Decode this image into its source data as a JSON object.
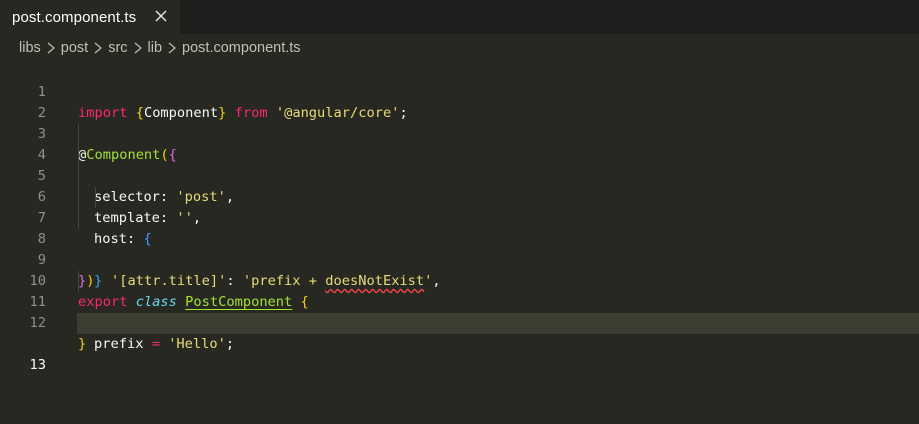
{
  "tab": {
    "label": "post.component.ts",
    "close_icon": "close-icon"
  },
  "breadcrumb": [
    "libs",
    "post",
    "src",
    "lib",
    "post.component.ts"
  ],
  "editor": {
    "current_line": 13,
    "lines": [
      {
        "n": "1"
      },
      {
        "n": "2"
      },
      {
        "n": "3"
      },
      {
        "n": "4"
      },
      {
        "n": "5"
      },
      {
        "n": "6"
      },
      {
        "n": "7"
      },
      {
        "n": "8"
      },
      {
        "n": "9"
      },
      {
        "n": "10"
      },
      {
        "n": "11"
      },
      {
        "n": "12"
      },
      {
        "n": "13"
      }
    ],
    "tokens": {
      "l1_import": "import",
      "l1_open": "{",
      "l1_component": "Component",
      "l1_close": "}",
      "l1_from": "from",
      "l1_str": "'@angular/core'",
      "l1_semi": ";",
      "l3_at": "@",
      "l3_decorator": "Component",
      "l3_paren": "(",
      "l3_brace": "{",
      "l4_key": "selector: ",
      "l4_str": "'post'",
      "l4_comma": ",",
      "l5_key": "template: ",
      "l5_str": "''",
      "l5_comma": ",",
      "l6_key": "host: ",
      "l6_brace": "{",
      "l7_key": "'[attr.title]'",
      "l7_colon": ": ",
      "l7_val1": "'prefix + ",
      "l7_err": "doesNotExist",
      "l7_val2": "'",
      "l7_comma": ",",
      "l8_brace": "}",
      "l9_brace": "}",
      "l9_paren": ")",
      "l10_export": "export",
      "l10_class": "class",
      "l10_name": "PostComponent",
      "l10_brace": "{",
      "l11_prop": "prefix ",
      "l11_eq": "=",
      "l11_str": "'Hello'",
      "l11_semi": ";",
      "l12_brace": "}"
    }
  },
  "colors": {
    "background": "#272822",
    "keyword": "#f92672",
    "string": "#e6db74",
    "function": "#a6e22e",
    "storage": "#66d9ef",
    "error_squiggle": "#f44747"
  }
}
